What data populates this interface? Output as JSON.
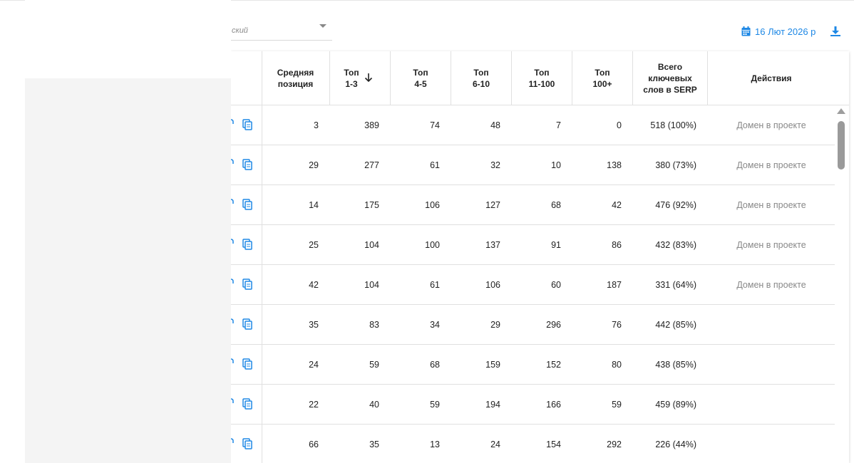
{
  "filter": {
    "select_value": "ский"
  },
  "date_button": {
    "label": "16 Лют 2026 р"
  },
  "table": {
    "headers": {
      "avg_position": [
        "Средняя",
        "позиция"
      ],
      "top_1_3": [
        "Топ",
        "1-3"
      ],
      "top_4_5": [
        "Топ",
        "4-5"
      ],
      "top_6_10": [
        "Топ",
        "6-10"
      ],
      "top_11_100": [
        "Топ",
        "11-100"
      ],
      "top_100_plus": [
        "Топ",
        "100+"
      ],
      "total_serp": [
        "Всего",
        "ключевых",
        "слов в SERP"
      ],
      "actions": "Действия"
    },
    "rows": [
      {
        "avg": "3",
        "t13": "389",
        "t45": "74",
        "t610": "48",
        "t11100": "7",
        "t100": "0",
        "total": "518 (100%)",
        "action": "Домен в проекте"
      },
      {
        "avg": "29",
        "t13": "277",
        "t45": "61",
        "t610": "32",
        "t11100": "10",
        "t100": "138",
        "total": "380 (73%)",
        "action": "Домен в проекте"
      },
      {
        "avg": "14",
        "t13": "175",
        "t45": "106",
        "t610": "127",
        "t11100": "68",
        "t100": "42",
        "total": "476 (92%)",
        "action": "Домен в проекте"
      },
      {
        "avg": "25",
        "t13": "104",
        "t45": "100",
        "t610": "137",
        "t11100": "91",
        "t100": "86",
        "total": "432 (83%)",
        "action": "Домен в проекте"
      },
      {
        "avg": "42",
        "t13": "104",
        "t45": "61",
        "t610": "106",
        "t11100": "60",
        "t100": "187",
        "total": "331 (64%)",
        "action": "Домен в проекте"
      },
      {
        "avg": "35",
        "t13": "83",
        "t45": "34",
        "t610": "29",
        "t11100": "296",
        "t100": "76",
        "total": "442 (85%)",
        "action": ""
      },
      {
        "avg": "24",
        "t13": "59",
        "t45": "68",
        "t610": "159",
        "t11100": "152",
        "t100": "80",
        "total": "438 (85%)",
        "action": ""
      },
      {
        "avg": "22",
        "t13": "40",
        "t45": "59",
        "t610": "194",
        "t11100": "166",
        "t100": "59",
        "total": "459 (89%)",
        "action": ""
      },
      {
        "avg": "66",
        "t13": "35",
        "t45": "13",
        "t610": "24",
        "t11100": "154",
        "t100": "292",
        "total": "226 (44%)",
        "action": ""
      }
    ]
  },
  "colors": {
    "accent": "#1e88e5",
    "muted_text": "#888888",
    "border": "#e0e0e0"
  },
  "icons": {
    "date": "calendar-icon",
    "download": "download-icon",
    "copy": "copy-icon",
    "sort": "arrow-down-icon"
  }
}
